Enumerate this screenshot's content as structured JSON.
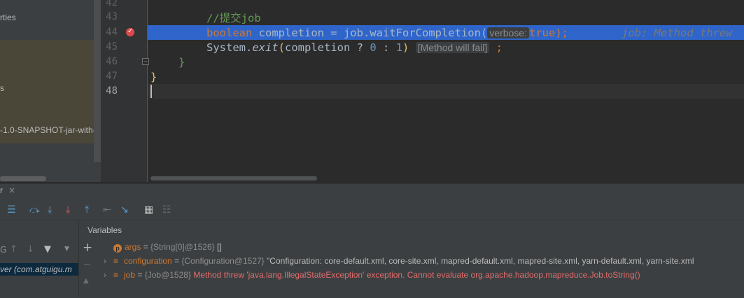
{
  "project": {
    "items": [
      "rties",
      "s",
      "-1.0-SNAPSHOT-jar-with-"
    ]
  },
  "editor": {
    "line_numbers": [
      "42",
      "43",
      "44",
      "45",
      "46",
      "47",
      "48"
    ],
    "comment": "//提交job",
    "line44": {
      "kw": "boolean",
      "code": " completion = job.waitForCompletion(",
      "hint": "verbose:",
      "value": "true",
      "end": ");",
      "inline": "job: Method threw"
    },
    "line45": {
      "prefix": "System.",
      "method": "exit",
      "paren_open": "(",
      "mid": "completion ? ",
      "zero": "0",
      "colon": " : ",
      "one": "1",
      "paren_close": ")",
      "hint": "[Method will fail]",
      "end": " ;"
    },
    "brace_inner": "}",
    "brace_outer": "}"
  },
  "debug": {
    "tab_label": "r",
    "tab_close": "×",
    "variables_title": "Variables",
    "frame_label": "ver (com.atguigu.m",
    "frames_toolbar_left": "G",
    "variables": [
      {
        "icon": "p",
        "expandable": false,
        "name": "args",
        "type": "{String[0]@1526}",
        "value": "[]",
        "error": false
      },
      {
        "icon": "f",
        "expandable": true,
        "name": "configuration",
        "type": "{Configuration@1527}",
        "value": "\"Configuration: core-default.xml, core-site.xml, mapred-default.xml, mapred-site.xml, yarn-default.xml, yarn-site.xml",
        "error": false
      },
      {
        "icon": "f",
        "expandable": true,
        "name": "job",
        "type": "{Job@1528}",
        "value": "Method threw 'java.lang.IllegalStateException' exception. Cannot evaluate org.apache.hadoop.mapreduce.Job.toString()",
        "error": true
      }
    ]
  },
  "colors": {
    "accent_blue": "#2f65ca",
    "keyword": "#cc7832",
    "error": "#e06c6c"
  }
}
